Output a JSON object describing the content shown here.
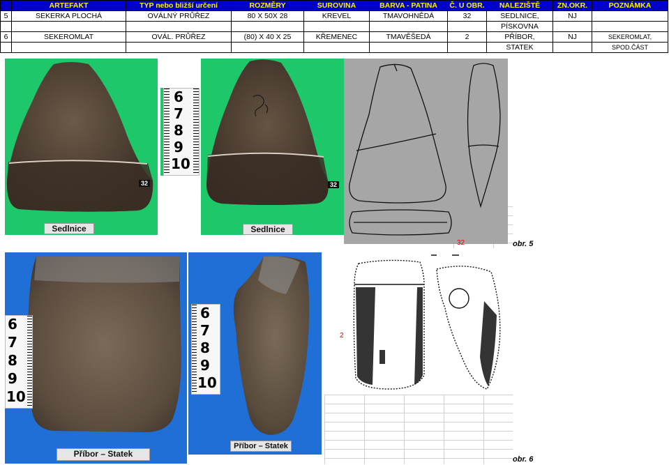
{
  "table": {
    "headers": [
      "",
      "ARTEFAKT",
      "TYP nebo bližší určení",
      "ROZMĚRY",
      "SUROVINA",
      "BARVA - PATINA",
      "Č. U OBR.",
      "NALEZIŠTĚ",
      "ZN.OKR.",
      "POZNÁMKA"
    ],
    "rows": [
      [
        "5",
        "SEKERKA PLOCHÁ",
        "OVÁLNÝ PRŮŘEZ",
        "80 X 50X 28",
        "KREVEL",
        "TMAVOHNĚDÁ",
        "32",
        "SEDLNICE,",
        "NJ",
        ""
      ],
      [
        "",
        "",
        "",
        "",
        "",
        "",
        "",
        "PÍSKOVNA",
        "",
        ""
      ],
      [
        "6",
        "SEKEROMLAT",
        "OVÁL. PRŮŘEZ",
        "(80) X 40 X 25",
        "KŘEMENEC",
        "TMAVĚŠEDÁ",
        "2",
        "PŘÍBOR,",
        "NJ",
        "SEKEROMLAT,"
      ],
      [
        "",
        "",
        "",
        "",
        "",
        "",
        "",
        "STATEK",
        "",
        "SPOD.ČÁST"
      ]
    ]
  },
  "figure5": {
    "label_left": "Sedlnice",
    "label_right": "Sedlnice",
    "number_tag_left": "32",
    "number_tag_right": "32",
    "drawing_number": "32",
    "caption": "obr. 5",
    "ruler": [
      "6",
      "7",
      "8",
      "9",
      "10"
    ]
  },
  "figure6": {
    "label_left": "Příbor – Statek",
    "label_right": "Příbor – Statek",
    "drawing_number": "2",
    "caption": "obr. 6",
    "ruler_left": [
      "6",
      "7",
      "8",
      "9",
      "10"
    ],
    "ruler_right": [
      "6",
      "7",
      "8",
      "9",
      "10"
    ]
  },
  "colors": {
    "header_bg": "#0000cc",
    "header_text": "#fff200",
    "photo5_bg": "#1ec86a",
    "photo6_bg": "#1f6fd6",
    "drawing5_bg": "#a6a6a6"
  }
}
